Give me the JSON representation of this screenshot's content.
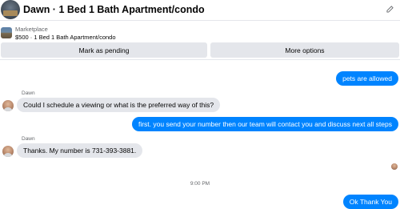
{
  "header": {
    "title": "Dawn · 1 Bed 1 Bath Apartment/condo",
    "avatar_icon": "apartment-photo-avatar",
    "menu_icon": "compose-icon"
  },
  "listing": {
    "label": "Marketplace",
    "detail": "$500 · 1 Bed 1 Bath Apartment/condo",
    "thumb_icon": "apartment-photo-thumbnail"
  },
  "actions": {
    "mark_pending": "Mark as pending",
    "more_options": "More options"
  },
  "messages": [
    {
      "direction": "out",
      "text": "pets are allowed"
    },
    {
      "direction": "in",
      "sender": "Dawn",
      "text": "Could I schedule a viewing or what is the preferred way of this?"
    },
    {
      "direction": "out",
      "text": "first. you send your number then our team will contact you and discuss next all steps"
    },
    {
      "direction": "in",
      "sender": "Dawn",
      "text": "Thanks.  My number is 731-393-3881."
    },
    {
      "direction": "out",
      "text": "Ok Thank You"
    }
  ],
  "timestamp": "9:00 PM",
  "colors": {
    "outgoing_bubble": "#0084ff",
    "incoming_bubble": "#e4e6eb",
    "button_bg": "#e4e6eb",
    "secondary_text": "#65676b"
  }
}
